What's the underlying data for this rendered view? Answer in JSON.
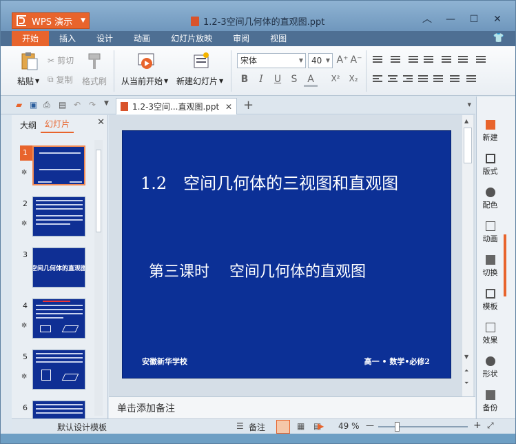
{
  "app": {
    "name": "WPS 演示",
    "doc_title": "1.2-3空间几何体的直观图.ppt"
  },
  "window_controls": {
    "chevron": "︿",
    "minimize": "—",
    "maximize": "☐",
    "close": "✕"
  },
  "menu": {
    "tabs": [
      "开始",
      "插入",
      "设计",
      "动画",
      "幻灯片放映",
      "审阅",
      "视图"
    ],
    "active": "开始"
  },
  "ribbon": {
    "paste": "粘贴",
    "cut": "剪切",
    "copy": "复制",
    "format_painter": "格式刷",
    "play_from_current": "从当前开始",
    "new_slide": "新建幻灯片",
    "font_name": "宋体",
    "font_size": "40",
    "bold": "B",
    "italic": "I",
    "underline": "U",
    "strike": "S",
    "font_color": "A",
    "superscript": "X²",
    "subscript": "X₂",
    "grow_font": "A⁺",
    "shrink_font": "A⁻"
  },
  "tabstrip": {
    "doc_tab": "1.2-3空间...直观图.ppt",
    "new_tab": "+"
  },
  "panel": {
    "tabs": [
      "大纲",
      "幻灯片"
    ],
    "active": "幻灯片",
    "close": "✕"
  },
  "thumbnails": [
    {
      "num": "1"
    },
    {
      "num": "2"
    },
    {
      "num": "3",
      "text": "空间几何体的直观图"
    },
    {
      "num": "4"
    },
    {
      "num": "5"
    },
    {
      "num": "6"
    }
  ],
  "slide": {
    "title": "1.2　空间几何体的三视图和直观图",
    "subtitle": "第三课时　 空间几何体的直观图",
    "school": "安徽新华学校",
    "course": "高一 • 数学•必修2"
  },
  "notes_placeholder": "单击添加备注",
  "right_sidebar": [
    "新建",
    "版式",
    "配色",
    "动画",
    "切换",
    "模板",
    "效果",
    "形状",
    "备份"
  ],
  "status": {
    "template": "默认设计模板",
    "notes": "备注",
    "zoom": "49 %"
  },
  "colors": {
    "accent": "#e8642c",
    "slide_bg": "#0c3096",
    "titlebar": "#7fa7cb"
  }
}
